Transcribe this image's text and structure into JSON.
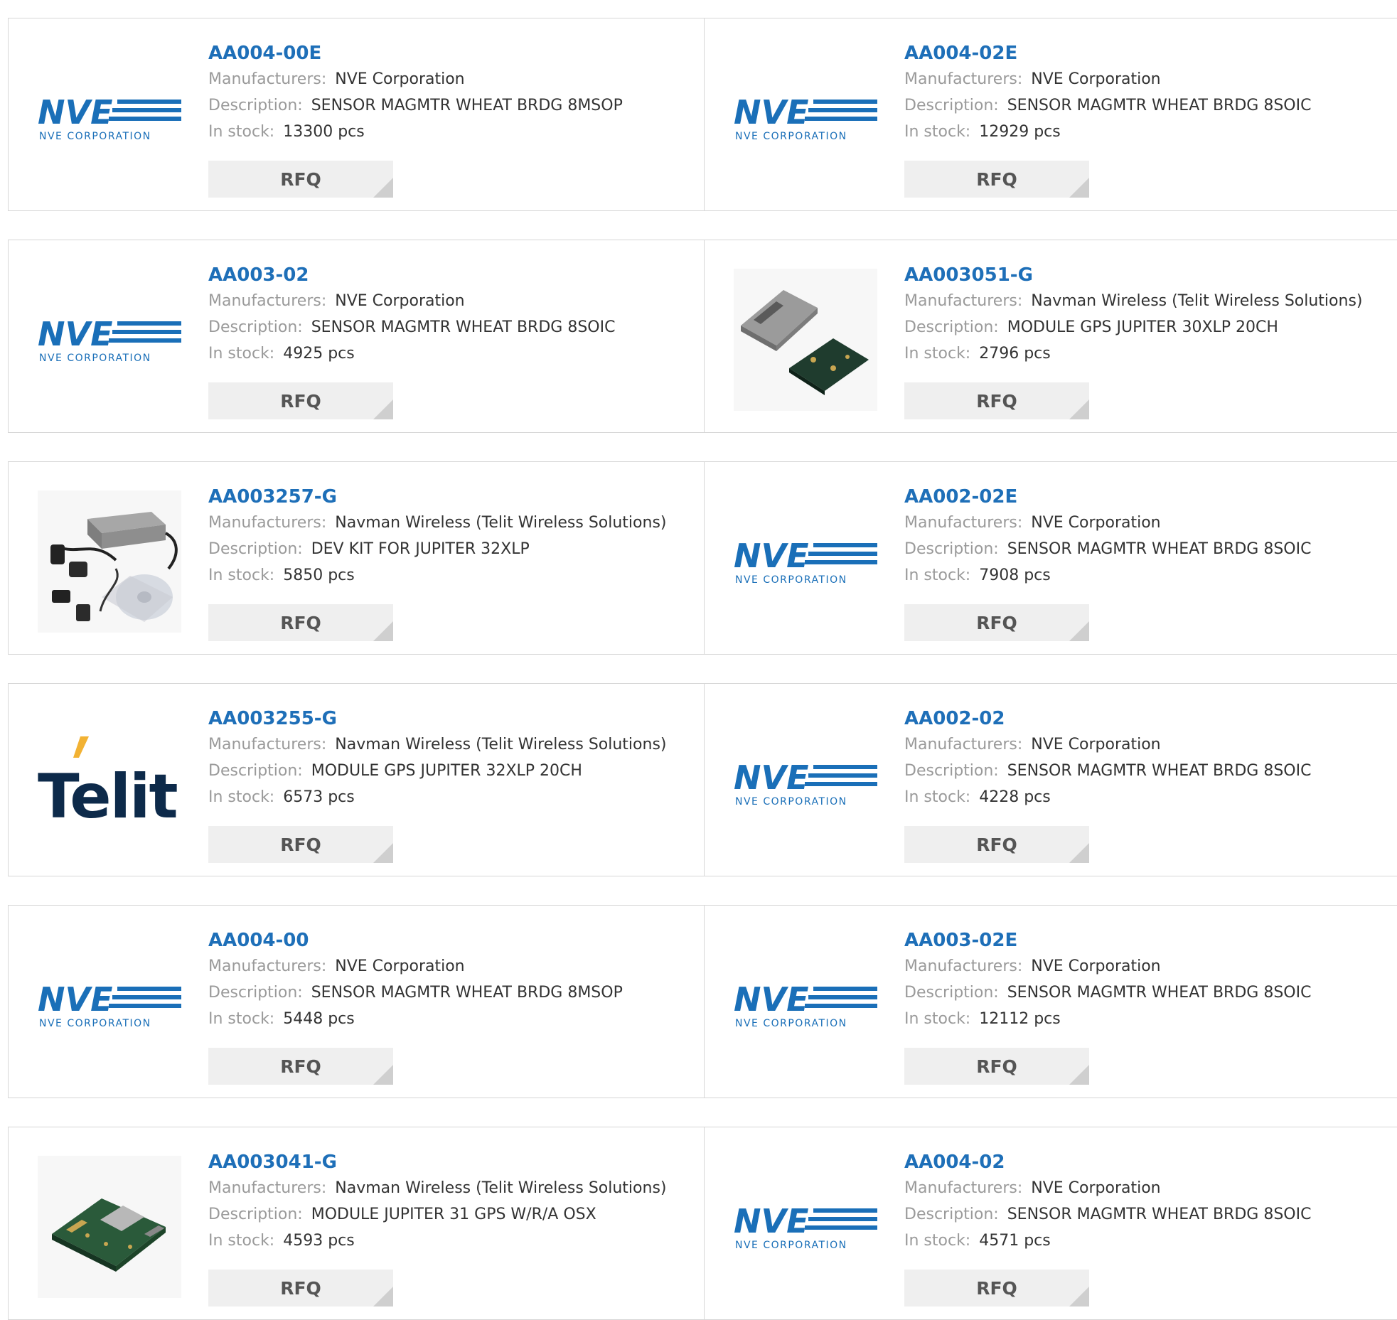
{
  "labels": {
    "manufacturers": "Manufacturers:",
    "description": "Description:",
    "stock": "In stock:",
    "rfq": "RFQ"
  },
  "logos": {
    "nve_word": "NVE",
    "nve_sub": "NVE CORPORATION",
    "telit_word": "Telit"
  },
  "colors": {
    "link": "#1e6fb8",
    "nve_blue": "#1a6fb8",
    "telit_navy": "#0d2a4a",
    "telit_accent": "#f2b233"
  },
  "products": [
    {
      "part": "AA004-00E",
      "manufacturer": "NVE Corporation",
      "description": "SENSOR MAGMTR WHEAT BRDG 8MSOP",
      "stock": "13300 pcs",
      "image": "nve-logo"
    },
    {
      "part": "AA004-02E",
      "manufacturer": "NVE Corporation",
      "description": "SENSOR MAGMTR WHEAT BRDG 8SOIC",
      "stock": "12929 pcs",
      "image": "nve-logo"
    },
    {
      "part": "AA003-02",
      "manufacturer": "NVE Corporation",
      "description": "SENSOR MAGMTR WHEAT BRDG 8SOIC",
      "stock": "4925 pcs",
      "image": "nve-logo"
    },
    {
      "part": "AA003051-G",
      "manufacturer": "Navman Wireless (Telit Wireless Solutions)",
      "description": "MODULE GPS JUPITER 30XLP 20CH",
      "stock": "2796 pcs",
      "image": "gps-module-photo"
    },
    {
      "part": "AA003257-G",
      "manufacturer": "Navman Wireless (Telit Wireless Solutions)",
      "description": "DEV KIT FOR JUPITER 32XLP",
      "stock": "5850 pcs",
      "image": "dev-kit-photo"
    },
    {
      "part": "AA002-02E",
      "manufacturer": "NVE Corporation",
      "description": "SENSOR MAGMTR WHEAT BRDG 8SOIC",
      "stock": "7908 pcs",
      "image": "nve-logo"
    },
    {
      "part": "AA003255-G",
      "manufacturer": "Navman Wireless (Telit Wireless Solutions)",
      "description": "MODULE GPS JUPITER 32XLP 20CH",
      "stock": "6573 pcs",
      "image": "telit-logo"
    },
    {
      "part": "AA002-02",
      "manufacturer": "NVE Corporation",
      "description": "SENSOR MAGMTR WHEAT BRDG 8SOIC",
      "stock": "4228 pcs",
      "image": "nve-logo"
    },
    {
      "part": "AA004-00",
      "manufacturer": "NVE Corporation",
      "description": "SENSOR MAGMTR WHEAT BRDG 8MSOP",
      "stock": "5448 pcs",
      "image": "nve-logo"
    },
    {
      "part": "AA003-02E",
      "manufacturer": "NVE Corporation",
      "description": "SENSOR MAGMTR WHEAT BRDG 8SOIC",
      "stock": "12112 pcs",
      "image": "nve-logo"
    },
    {
      "part": "AA003041-G",
      "manufacturer": "Navman Wireless (Telit Wireless Solutions)",
      "description": "MODULE JUPITER 31 GPS W/R/A OSX",
      "stock": "4593 pcs",
      "image": "gps-board-photo"
    },
    {
      "part": "AA004-02",
      "manufacturer": "NVE Corporation",
      "description": "SENSOR MAGMTR WHEAT BRDG 8SOIC",
      "stock": "4571 pcs",
      "image": "nve-logo"
    }
  ]
}
